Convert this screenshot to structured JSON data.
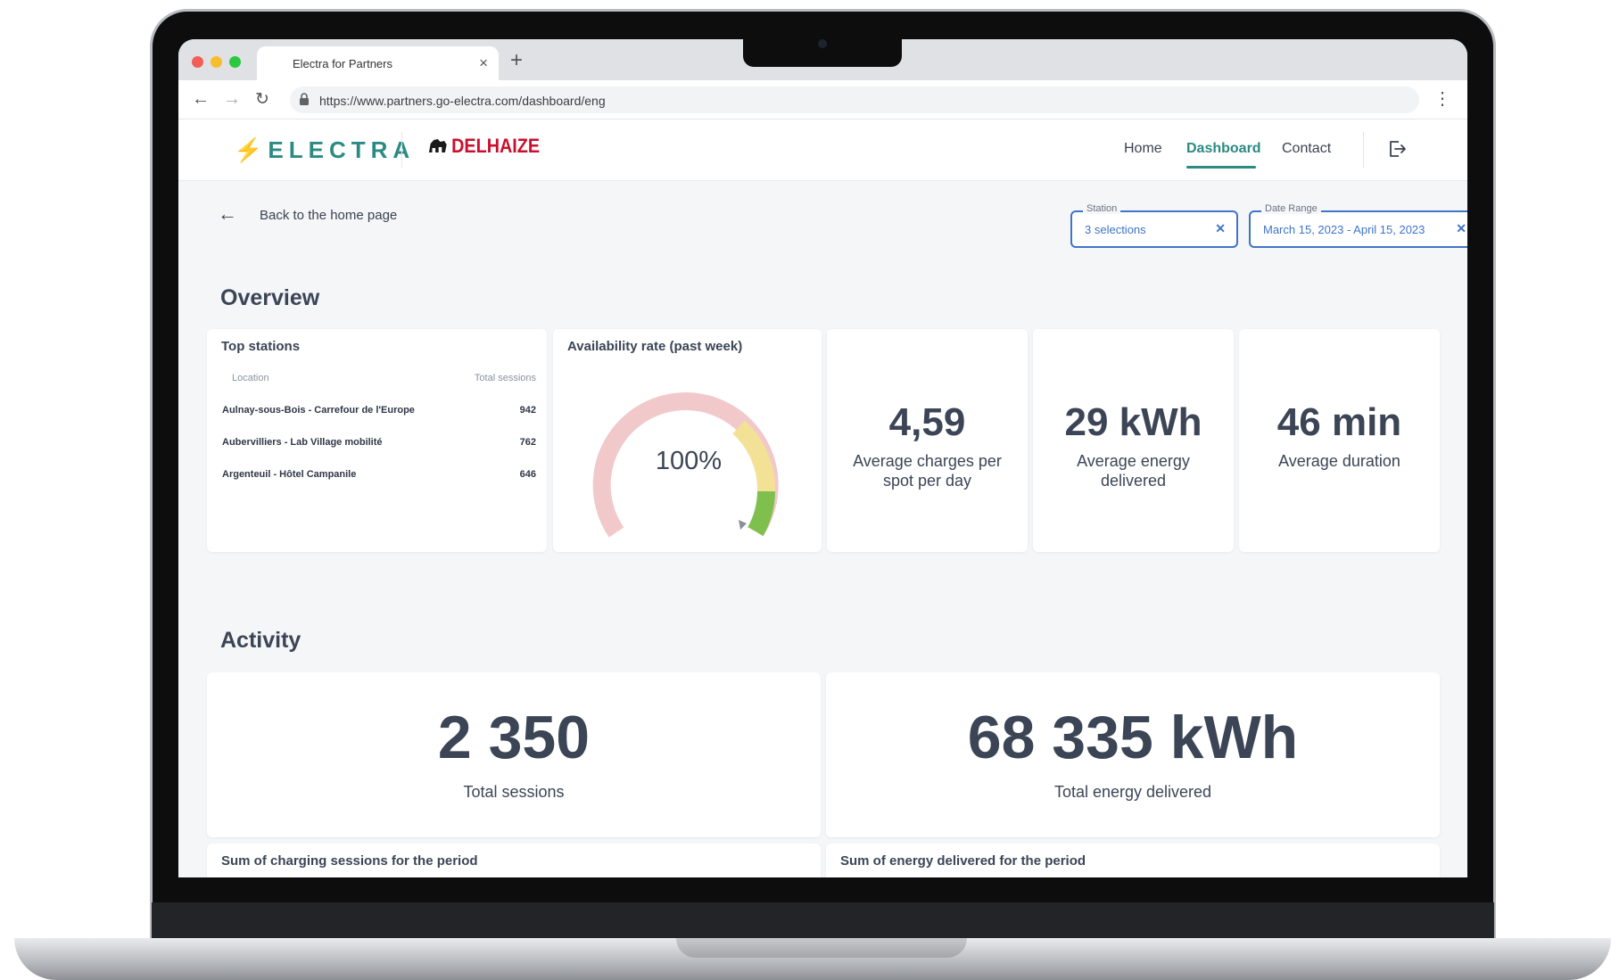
{
  "browser": {
    "tab_title": "Electra for Partners",
    "url": "https://www.partners.go-electra.com/dashboard/eng"
  },
  "header": {
    "brand": "ELECTRA",
    "partner": "DELHAIZE",
    "nav": {
      "home": "Home",
      "dashboard": "Dashboard",
      "contact": "Contact"
    },
    "accent_color": "#2b8a82"
  },
  "toolbar": {
    "back_label": "Back to the home page",
    "station_filter": {
      "legend": "Station",
      "value": "3 selections"
    },
    "date_filter": {
      "legend": "Date Range",
      "value": "March 15, 2023 - April 15, 2023"
    }
  },
  "overview": {
    "title": "Overview",
    "top_stations": {
      "title": "Top stations",
      "col_location": "Location",
      "col_sessions": "Total sessions",
      "rows": [
        {
          "location": "Aulnay-sous-Bois - Carrefour de l'Europe",
          "sessions": "942"
        },
        {
          "location": "Aubervilliers - Lab Village mobilité",
          "sessions": "762"
        },
        {
          "location": "Argenteuil - Hôtel Campanile",
          "sessions": "646"
        }
      ]
    },
    "availability": {
      "title": "Availability rate (past week)",
      "value": "100%",
      "level": 1.0
    },
    "kpis": [
      {
        "value": "4,59",
        "label": "Average charges per spot per day"
      },
      {
        "value": "29 kWh",
        "label": "Average energy delivered"
      },
      {
        "value": "46 min",
        "label": "Average duration"
      }
    ]
  },
  "activity": {
    "title": "Activity",
    "total_sessions": {
      "value": "2 350",
      "label": "Total sessions"
    },
    "total_energy": {
      "value": "68 335 kWh",
      "label": "Total energy delivered"
    },
    "sessions_chart_title": "Sum of charging sessions for the period",
    "energy_chart_title": "Sum of energy delivered for the period"
  }
}
